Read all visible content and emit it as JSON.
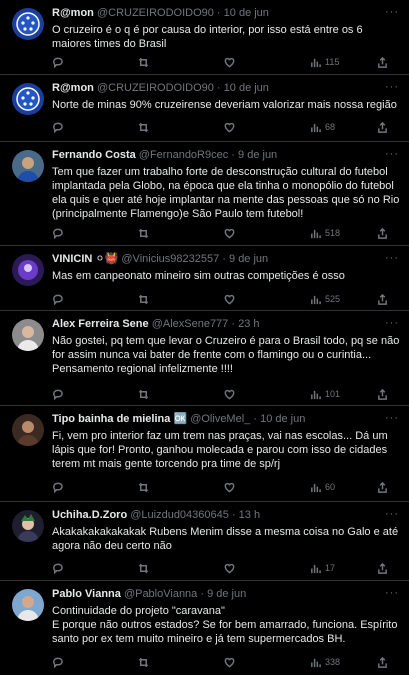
{
  "colors": {
    "background": "#000000",
    "text": "#e7e9ea",
    "muted": "#71767b",
    "divider": "#2f3336"
  },
  "tweets": [
    {
      "name": "R@mon",
      "handle": "@CRUZEIRODOIDO90",
      "date": "10 de jun",
      "text": "O cruzeiro é o q é por causa do interior,  por isso está entre os 6 maiores times do Brasil",
      "views": "115",
      "avatar": "cruzeiro-logo"
    },
    {
      "name": "R@mon",
      "handle": "@CRUZEIRODOIDO90",
      "date": "10 de jun",
      "text": "Norte de minas 90% cruzeirense deveriam valorizar mais nossa região",
      "views": "68",
      "avatar": "cruzeiro-logo"
    },
    {
      "name": "Fernando Costa",
      "handle": "@FernandoR9cec",
      "date": "9 de jun",
      "text": "Tem que fazer um trabalho forte de desconstrução cultural do futebol implantada pela Globo, na época que ela tinha o monopólio do futebol ela quis e quer até hoje implantar na mente das pessoas que só no Rio (principalmente Flamengo)e São Paulo tem futebol!",
      "views": "518",
      "avatar": "person-photo"
    },
    {
      "name": "VINICIN",
      "name_emoji": "⚪👹",
      "handle": "@Vinicius98232557",
      "date": "9 de jun",
      "text": "Mas em canpeonato mineiro sim outras competições é osso",
      "views": "525",
      "avatar": "purple-avatar"
    },
    {
      "name": "Alex Ferreira Sene",
      "handle": "@AlexSene777",
      "date": "23 h",
      "text": "Não gostei, pq tem que levar o Cruzeiro é para o Brasil todo, pq se não for assim nunca vai bater de frente com o flamingo ou o curintia... Pensamento regional infelizmente !!!!",
      "views": "101",
      "avatar": "person-photo"
    },
    {
      "name": "Tipo bainha de mielina",
      "name_emoji": "🆗",
      "handle": "@OliveMel_",
      "date": "10 de jun",
      "text": "Fi, vem pro interior faz um trem nas praças, vai nas escolas... Dá um lápis que for! Pronto, ganhou molecada e parou com isso de cidades terem mt mais gente torcendo pra time de sp/rj",
      "views": "60",
      "avatar": "person-photo"
    },
    {
      "name": "Uchiha.D.Zoro",
      "handle": "@Luizdud04360645",
      "date": "13 h",
      "text": "Akakakakakakakak Rubens Menim disse a mesma coisa no Galo e até agora não deu certo não",
      "views": "17",
      "avatar": "anime-avatar"
    },
    {
      "name": "Pablo Vianna",
      "handle": "@PabloVianna",
      "date": "9 de jun",
      "text": "Continuidade do projeto \"caravana\"\nE porque não outros estados? Se for bem amarrado, funciona. Espírito santo por ex tem muito mineiro e já tem supermercados BH.",
      "views": "338",
      "avatar": "person-photo"
    }
  ]
}
